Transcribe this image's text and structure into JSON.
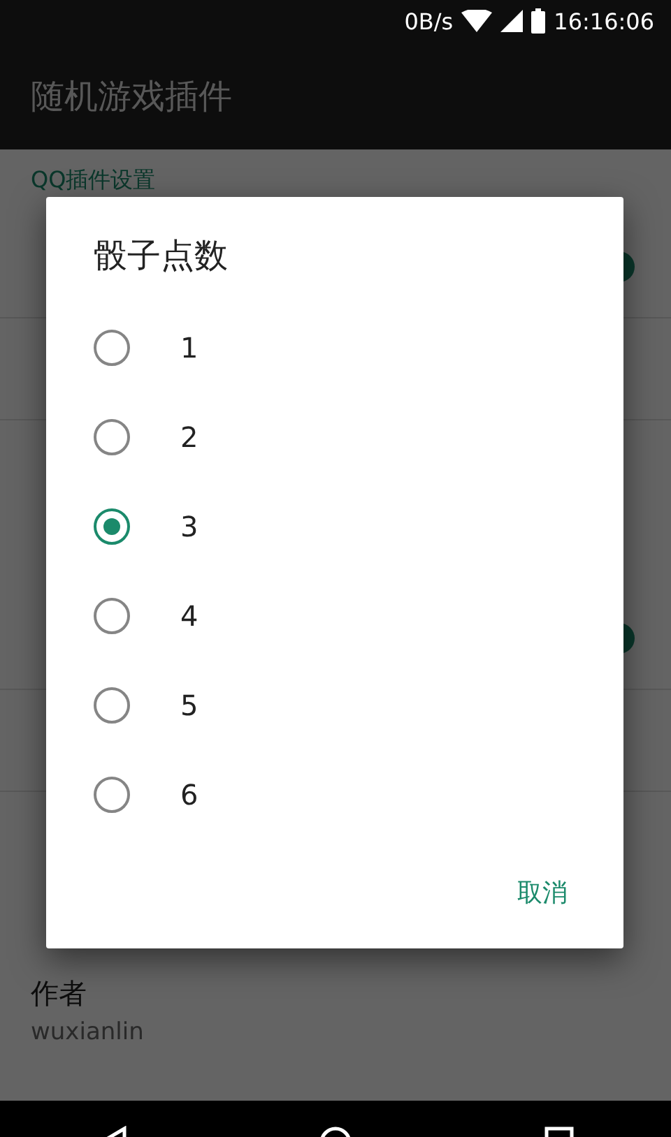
{
  "status_bar": {
    "speed": "0B/s",
    "time": "16:16:06"
  },
  "app_bar": {
    "title": "随机游戏插件"
  },
  "sections": [
    {
      "title": "QQ插件设置",
      "items": [
        {
          "kind": "switch",
          "on": true
        },
        {
          "kind": "plain"
        },
        {
          "kind": "plain"
        }
      ]
    },
    {
      "items": [
        {
          "kind": "switch",
          "on": true
        },
        {
          "kind": "plain"
        },
        {
          "kind": "plain"
        }
      ]
    },
    {
      "items": [
        {
          "kind": "plain",
          "title": "作者",
          "summary": "wuxianlin"
        }
      ]
    }
  ],
  "dialog": {
    "title": "骰子点数",
    "options": [
      {
        "label": "1",
        "selected": false
      },
      {
        "label": "2",
        "selected": false
      },
      {
        "label": "3",
        "selected": true
      },
      {
        "label": "4",
        "selected": false
      },
      {
        "label": "5",
        "selected": false
      },
      {
        "label": "6",
        "selected": false
      }
    ],
    "buttons": [
      "取消"
    ]
  }
}
